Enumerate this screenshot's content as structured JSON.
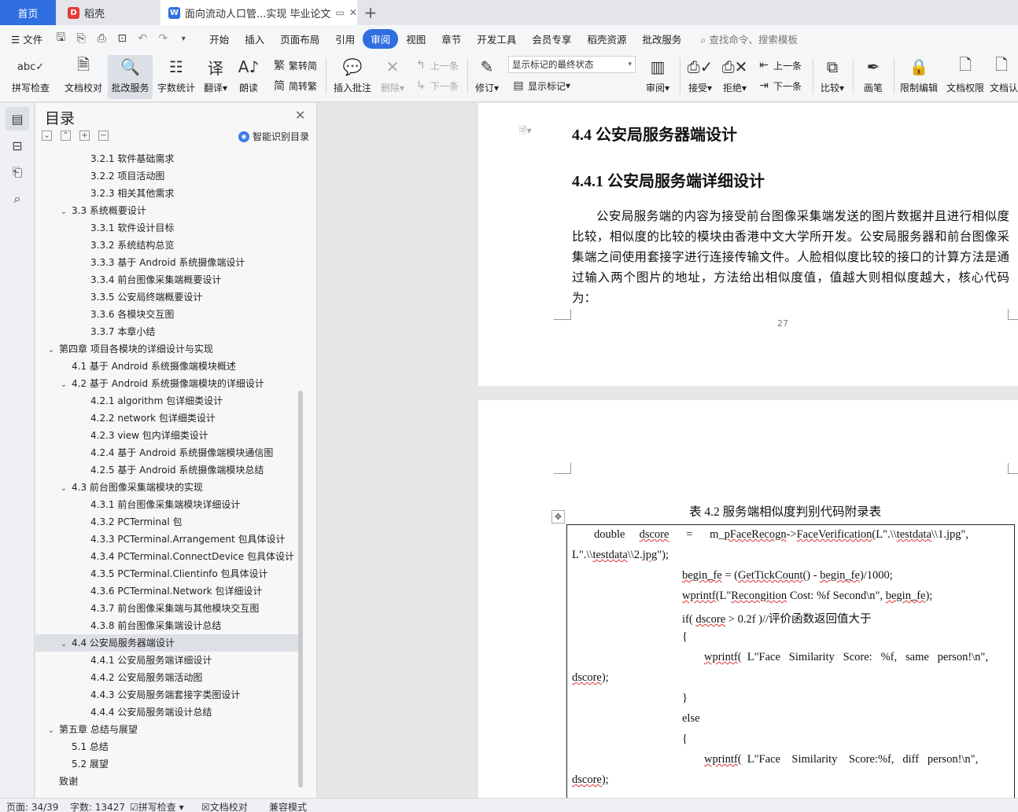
{
  "tabs": {
    "home": "首页",
    "daoke": "稻壳",
    "document": "面向流动人口管...实现 毕业论文",
    "add": "+"
  },
  "menu": {
    "file": "文件",
    "items": [
      "开始",
      "插入",
      "页面布局",
      "引用",
      "审阅",
      "视图",
      "章节",
      "开发工具",
      "会员专享",
      "稻壳资源",
      "批改服务"
    ],
    "active": "审阅",
    "search": "查找命令、搜索模板"
  },
  "ribbon": {
    "spellcheck": "拼写检查",
    "doccheck": "文档校对",
    "review_service": "批改服务",
    "wordcount": "字数统计",
    "translate": "翻译",
    "read": "朗读",
    "to_traditional": "繁转简",
    "to_simplified": "简转繁",
    "insert_comment": "插入批注",
    "delete": "删除",
    "prev_comment": "上一条",
    "next_comment": "下一条",
    "revise": "修订",
    "markup_state": "显示标记的最终状态",
    "show_markup": "显示标记",
    "review": "审阅",
    "accept": "接受",
    "reject": "拒绝",
    "prev": "上一条",
    "next": "下一条",
    "compare": "比较",
    "pen": "画笔",
    "restrict_edit": "限制编辑",
    "doc_rights": "文档权限",
    "doc_cert": "文档认"
  },
  "toc": {
    "title": "目录",
    "smart": "智能识别目录",
    "items": [
      {
        "label": "3.2.1 软件基础需求",
        "level": 3,
        "tw": ""
      },
      {
        "label": "3.2.2 项目活动图",
        "level": 3,
        "tw": ""
      },
      {
        "label": "3.2.3 相关其他需求",
        "level": 3,
        "tw": ""
      },
      {
        "label": "3.3  系统概要设计",
        "level": 2,
        "tw": "v"
      },
      {
        "label": "3.3.1  软件设计目标",
        "level": 3,
        "tw": ""
      },
      {
        "label": "3.3.2  系统结构总览",
        "level": 3,
        "tw": ""
      },
      {
        "label": "3.3.3  基于 Android 系统摄像端设计",
        "level": 3,
        "tw": ""
      },
      {
        "label": "3.3.4  前台图像采集端概要设计",
        "level": 3,
        "tw": ""
      },
      {
        "label": "3.3.5  公安局终端概要设计",
        "level": 3,
        "tw": ""
      },
      {
        "label": "3.3.6 各模块交互图",
        "level": 3,
        "tw": ""
      },
      {
        "label": "3.3.7 本章小结",
        "level": 3,
        "tw": ""
      },
      {
        "label": "第四章  项目各模块的详细设计与实现",
        "level": 1,
        "tw": "v"
      },
      {
        "label": "4.1  基于 Android 系统摄像端模块概述",
        "level": 2,
        "tw": ""
      },
      {
        "label": "4.2  基于 Android 系统摄像端模块的详细设计",
        "level": 2,
        "tw": "v"
      },
      {
        "label": "4.2.1 algorithm 包详细类设计",
        "level": 3,
        "tw": ""
      },
      {
        "label": "4.2.2 network 包详细类设计",
        "level": 3,
        "tw": ""
      },
      {
        "label": "4.2.3 view 包内详细类设计",
        "level": 3,
        "tw": ""
      },
      {
        "label": "4.2.4  基于 Android 系统摄像端模块通信图",
        "level": 3,
        "tw": ""
      },
      {
        "label": "4.2.5  基于 Android 系统摄像端模块总结",
        "level": 3,
        "tw": ""
      },
      {
        "label": "4.3  前台图像采集端模块的实现",
        "level": 2,
        "tw": "v"
      },
      {
        "label": "4.3.1  前台图像采集端模块详细设计",
        "level": 3,
        "tw": ""
      },
      {
        "label": "4.3.2 PCTerminal 包",
        "level": 3,
        "tw": ""
      },
      {
        "label": "4.3.3 PCTerminal.Arrangement 包具体设计",
        "level": 3,
        "tw": ""
      },
      {
        "label": "4.3.4 PCTerminal.ConnectDevice 包具体设计",
        "level": 3,
        "tw": ""
      },
      {
        "label": "4.3.5 PCTerminal.Clientinfo 包具体设计",
        "level": 3,
        "tw": ""
      },
      {
        "label": "4.3.6 PCTerminal.Network 包详细设计",
        "level": 3,
        "tw": ""
      },
      {
        "label": "4.3.7  前台图像采集端与其他模块交互图",
        "level": 3,
        "tw": ""
      },
      {
        "label": "4.3.8  前台图像采集端设计总结",
        "level": 3,
        "tw": ""
      },
      {
        "label": "4.4 公安局服务器端设计",
        "level": 2,
        "tw": "v",
        "selected": true
      },
      {
        "label": "4.4.1 公安局服务端详细设计",
        "level": 3,
        "tw": ""
      },
      {
        "label": "4.4.2 公安局服务端活动图",
        "level": 3,
        "tw": ""
      },
      {
        "label": "4.4.3 公安局服务端套接字类图设计",
        "level": 3,
        "tw": ""
      },
      {
        "label": "4.4.4 公安局服务端设计总结",
        "level": 3,
        "tw": ""
      },
      {
        "label": "第五章  总结与展望",
        "level": 1,
        "tw": "v"
      },
      {
        "label": "5.1  总结",
        "level": 2,
        "tw": ""
      },
      {
        "label": "5.2  展望",
        "level": 2,
        "tw": ""
      },
      {
        "label": "致谢",
        "level": 1,
        "tw": ""
      }
    ]
  },
  "doc": {
    "h_44": "4.4 公安局服务器端设计",
    "h_441": "4.4.1 公安局服务端详细设计",
    "para": "公安局服务端的内容为接受前台图像采集端发送的图片数据并且进行相似度比较，相似度的比较的模块由香港中文大学所开发。公安局服务器和前台图像采集端之间使用套接字进行连接传输文件。人脸相似度比较的接口的计算方法是通过输入两个图片的地址，方法给出相似度值，值越大则相似度越大，核心代码为：",
    "page_number": "27",
    "table_caption": "表 4.2 服务端相似度判别代码附录表"
  },
  "status": {
    "page": "页面: 34/39",
    "words": "字数: 13427",
    "spell": "拼写检查",
    "proof": "文档校对",
    "compat": "兼容模式"
  }
}
